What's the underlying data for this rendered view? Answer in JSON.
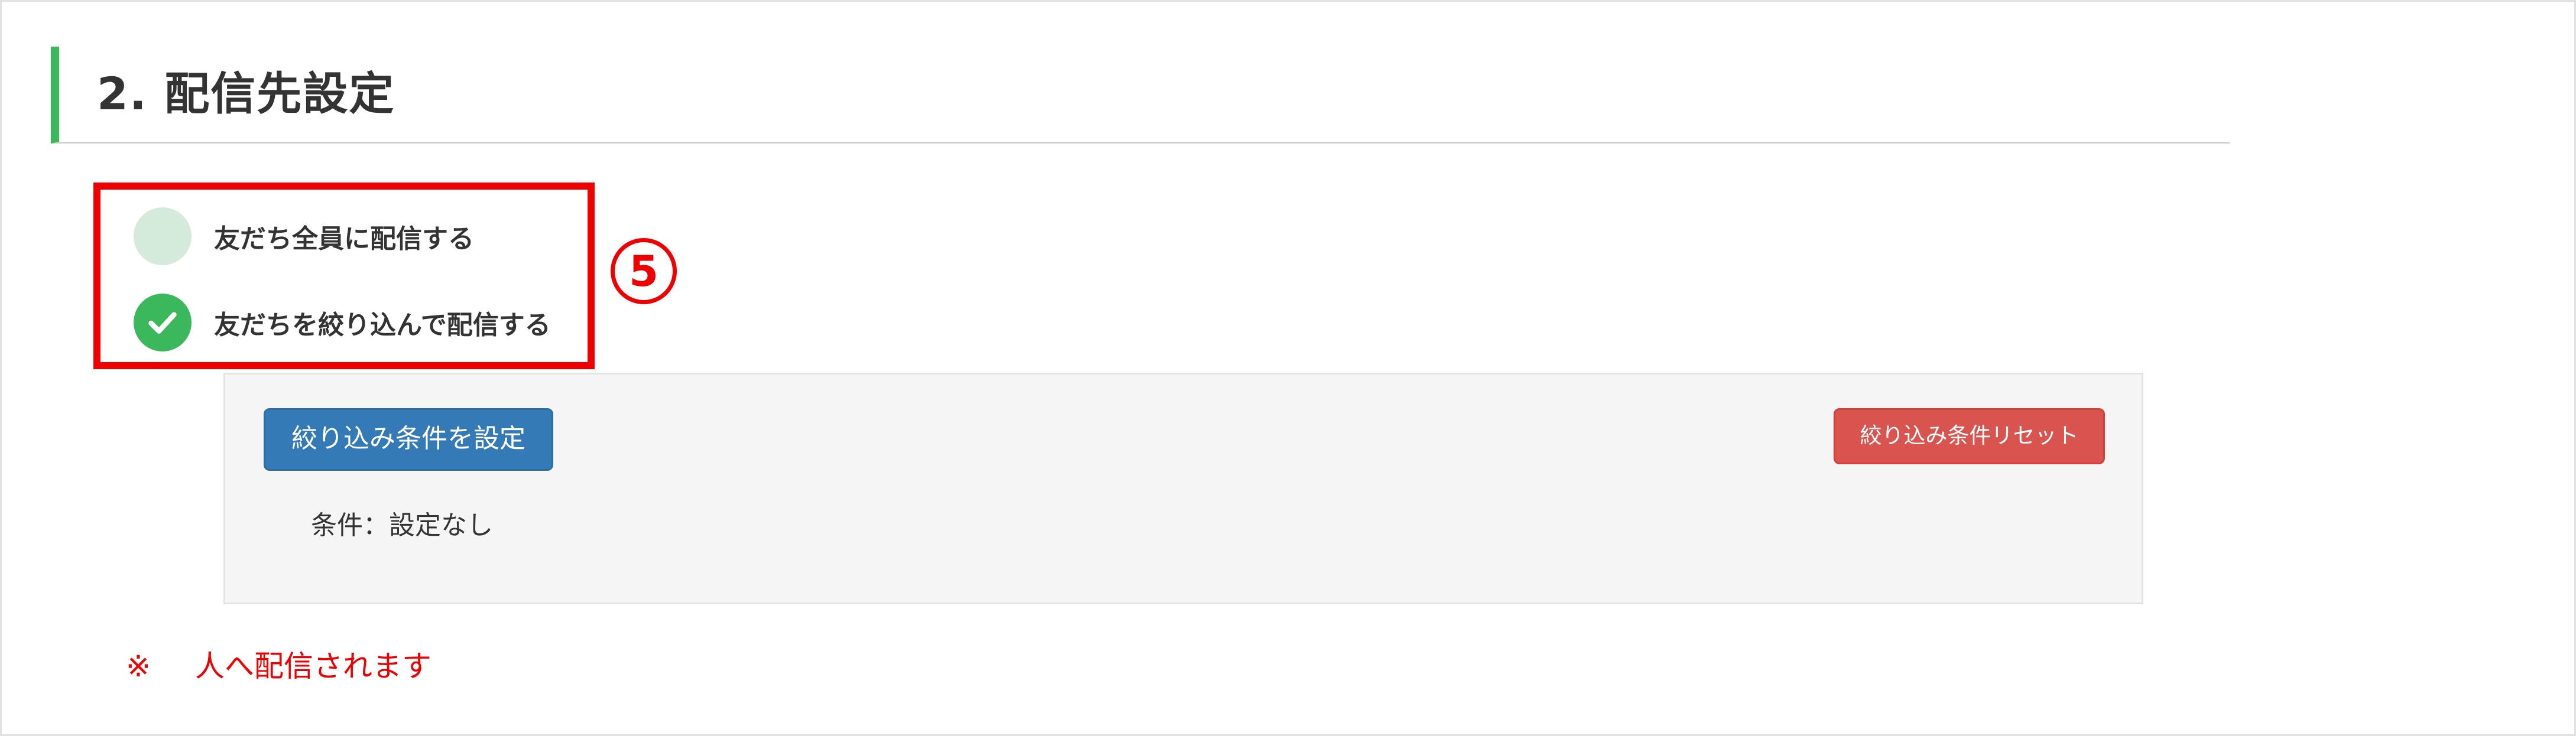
{
  "section": {
    "title": "2. 配信先設定"
  },
  "radio_group": {
    "options": [
      {
        "label": "友だち全員に配信する",
        "selected": false
      },
      {
        "label": "友だちを絞り込んで配信する",
        "selected": true
      }
    ]
  },
  "annotation": {
    "number": "5"
  },
  "filter_panel": {
    "set_button_label": "絞り込み条件を設定",
    "reset_button_label": "絞り込み条件リセット",
    "condition_text": "条件：設定なし"
  },
  "delivery_note": {
    "mark": "※",
    "text": "人へ配信されます"
  },
  "colors": {
    "accent_green": "#3cb85c",
    "highlight_red": "#ee0000",
    "primary_blue": "#337ab7",
    "danger_red": "#d9534f"
  }
}
